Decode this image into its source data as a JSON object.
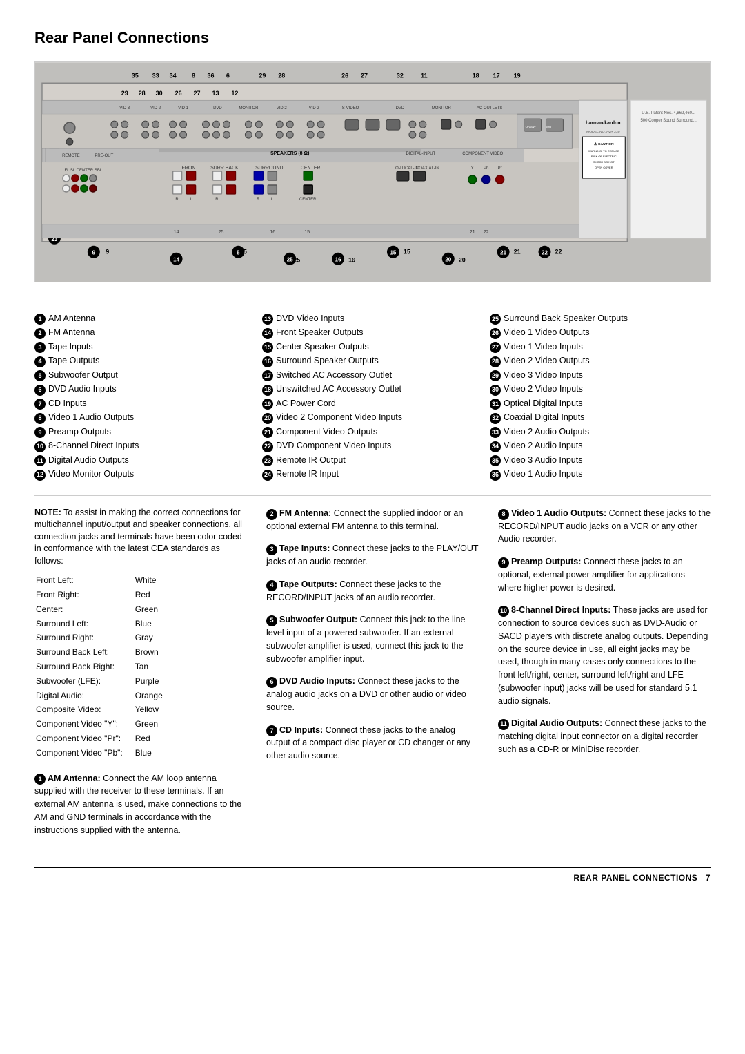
{
  "page": {
    "title": "Rear Panel Connections",
    "footer_text": "REAR PANEL CONNECTIONS",
    "footer_page": "7"
  },
  "legend": {
    "col1": [
      {
        "num": "1",
        "text": "AM Antenna"
      },
      {
        "num": "2",
        "text": "FM Antenna"
      },
      {
        "num": "3",
        "text": "Tape Inputs"
      },
      {
        "num": "4",
        "text": "Tape Outputs"
      },
      {
        "num": "5",
        "text": "Subwoofer Output"
      },
      {
        "num": "6",
        "text": "DVD Audio Inputs"
      },
      {
        "num": "7",
        "text": "CD Inputs"
      },
      {
        "num": "8",
        "text": "Video 1 Audio Outputs"
      },
      {
        "num": "9",
        "text": "Preamp Outputs"
      },
      {
        "num": "10",
        "text": "8-Channel Direct Inputs"
      },
      {
        "num": "11",
        "text": "Digital Audio Outputs"
      },
      {
        "num": "12",
        "text": "Video Monitor Outputs"
      }
    ],
    "col2": [
      {
        "num": "13",
        "text": "DVD Video Inputs"
      },
      {
        "num": "14",
        "text": "Front Speaker Outputs"
      },
      {
        "num": "15",
        "text": "Center Speaker Outputs"
      },
      {
        "num": "16",
        "text": "Surround Speaker Outputs"
      },
      {
        "num": "17",
        "text": "Switched AC Accessory Outlet"
      },
      {
        "num": "18",
        "text": "Unswitched AC Accessory Outlet"
      },
      {
        "num": "19",
        "text": "AC Power Cord"
      },
      {
        "num": "20",
        "text": "Video 2 Component Video Inputs"
      },
      {
        "num": "21",
        "text": "Component Video Outputs"
      },
      {
        "num": "22",
        "text": "DVD Component Video Inputs"
      },
      {
        "num": "23",
        "text": "Remote IR Output"
      },
      {
        "num": "24",
        "text": "Remote IR Input"
      }
    ],
    "col3": [
      {
        "num": "25",
        "text": "Surround Back Speaker Outputs"
      },
      {
        "num": "26",
        "text": "Video 1 Video Outputs"
      },
      {
        "num": "27",
        "text": "Video 1 Video Inputs"
      },
      {
        "num": "28",
        "text": "Video 2 Video Outputs"
      },
      {
        "num": "29",
        "text": "Video 3 Video Inputs"
      },
      {
        "num": "30",
        "text": "Video 2 Video Inputs"
      },
      {
        "num": "31",
        "text": "Optical Digital Inputs"
      },
      {
        "num": "32",
        "text": "Coaxial Digital Inputs"
      },
      {
        "num": "33",
        "text": "Video 2 Audio Outputs"
      },
      {
        "num": "34",
        "text": "Video 2 Audio Inputs"
      },
      {
        "num": "35",
        "text": "Video 3 Audio Inputs"
      },
      {
        "num": "36",
        "text": "Video 1 Audio Inputs"
      }
    ]
  },
  "note": {
    "intro": "NOTE: To assist in making the correct connections for multichannel input/output and speaker connections, all connection jacks and terminals have been color coded in conformance with the latest CEA standards as follows:",
    "colors": [
      {
        "channel": "Front Left:",
        "color": "White"
      },
      {
        "channel": "Front Right:",
        "color": "Red"
      },
      {
        "channel": "Center:",
        "color": "Green"
      },
      {
        "channel": "Surround Left:",
        "color": "Blue"
      },
      {
        "channel": "Surround Right:",
        "color": "Gray"
      },
      {
        "channel": "Surround Back Left:",
        "color": "Brown"
      },
      {
        "channel": "Surround Back Right:",
        "color": "Tan"
      },
      {
        "channel": "Subwoofer (LFE):",
        "color": "Purple"
      },
      {
        "channel": "Digital Audio:",
        "color": "Orange"
      },
      {
        "channel": "Composite Video:",
        "color": "Yellow"
      },
      {
        "channel": "Component Video \"Y\":",
        "color": "Green"
      },
      {
        "channel": "Component Video \"Pr\":",
        "color": "Red"
      },
      {
        "channel": "Component Video \"Pb\":",
        "color": "Blue"
      }
    ]
  },
  "entries": {
    "col1": [
      {
        "num": "1",
        "title": "AM Antenna:",
        "text": "Connect the AM loop antenna supplied with the receiver to these terminals. If an external AM antenna is used, make connections to the AM and GND terminals in accordance with the instructions supplied with the antenna."
      }
    ],
    "col2": [
      {
        "num": "2",
        "title": "FM Antenna:",
        "text": "Connect the supplied indoor or an optional external FM antenna to this terminal."
      },
      {
        "num": "3",
        "title": "Tape Inputs:",
        "text": "Connect these jacks to the PLAY/OUT jacks of an audio recorder."
      },
      {
        "num": "4",
        "title": "Tape Outputs:",
        "text": "Connect these jacks to the RECORD/INPUT jacks of an audio recorder."
      },
      {
        "num": "5",
        "title": "Subwoofer Output:",
        "text": "Connect this jack to the line-level input of a powered subwoofer. If an external subwoofer amplifier is used, connect this jack to the subwoofer amplifier input."
      },
      {
        "num": "6",
        "title": "DVD Audio Inputs:",
        "text": "Connect these jacks to the analog audio jacks on a DVD or other audio or video source."
      },
      {
        "num": "7",
        "title": "CD Inputs:",
        "text": "Connect these jacks to the analog output of a compact disc player or CD changer or any other audio source."
      }
    ],
    "col3": [
      {
        "num": "8",
        "title": "Video 1 Audio Outputs:",
        "text": "Connect these jacks to the RECORD/INPUT audio jacks on a VCR or any other Audio recorder."
      },
      {
        "num": "9",
        "title": "Preamp Outputs:",
        "text": "Connect these jacks to an optional, external power amplifier for applications where higher power is desired."
      },
      {
        "num": "10",
        "title": "8-Channel Direct Inputs:",
        "text": "These jacks are used for connection to source devices such as DVD-Audio or SACD players with discrete analog outputs. Depending on the source device in use, all eight jacks may be used, though in many cases only connections to the front left/right, center, surround left/right and LFE (subwoofer input) jacks will be used for standard 5.1 audio signals."
      },
      {
        "num": "11",
        "title": "Digital Audio Outputs:",
        "text": "Connect these jacks to the matching digital input connector on a digital recorder such as a CD-R or MiniDisc recorder."
      }
    ]
  }
}
